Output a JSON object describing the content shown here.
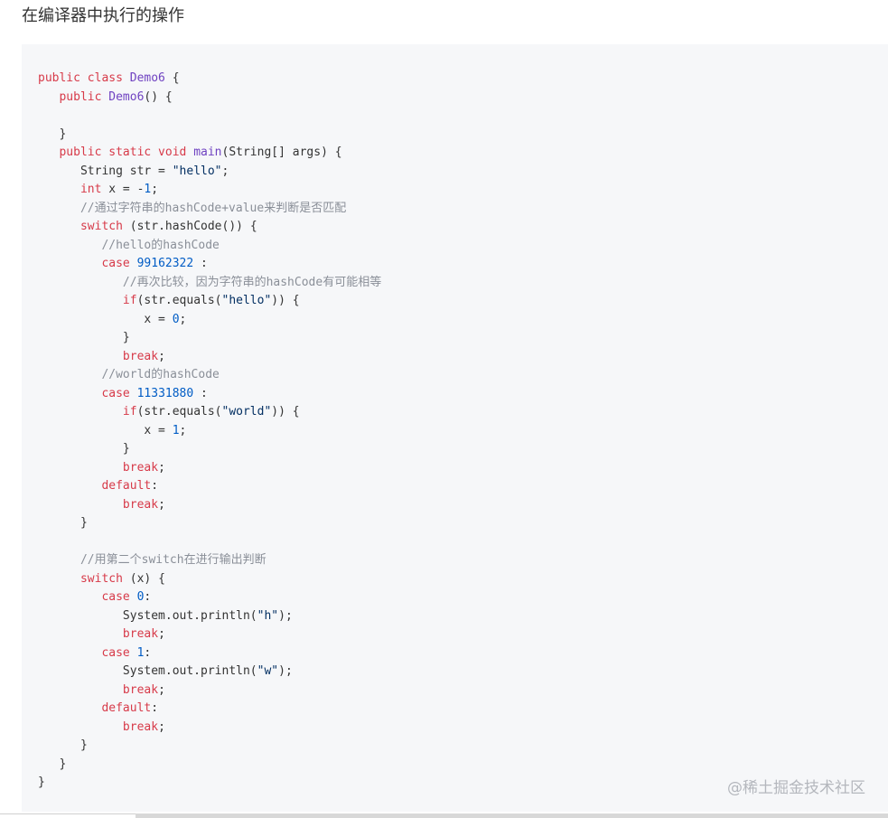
{
  "heading": "在编译器中执行的操作",
  "watermark": "@稀土掘金技术社区",
  "code_lines": [
    [
      {
        "t": "public class ",
        "c": "kw"
      },
      {
        "t": "Demo6",
        "c": "fn"
      },
      {
        "t": " {",
        "c": ""
      }
    ],
    [
      {
        "t": "   public ",
        "c": "kw"
      },
      {
        "t": "Demo6",
        "c": "fn"
      },
      {
        "t": "() {",
        "c": ""
      }
    ],
    [
      {
        "t": "",
        "c": ""
      }
    ],
    [
      {
        "t": "   }",
        "c": ""
      }
    ],
    [
      {
        "t": "   public static void ",
        "c": "kw"
      },
      {
        "t": "main",
        "c": "fn"
      },
      {
        "t": "(String[] args) {",
        "c": ""
      }
    ],
    [
      {
        "t": "      String str = ",
        "c": ""
      },
      {
        "t": "\"hello\"",
        "c": "str"
      },
      {
        "t": ";",
        "c": ""
      }
    ],
    [
      {
        "t": "      ",
        "c": ""
      },
      {
        "t": "int",
        "c": "kw"
      },
      {
        "t": " x = -",
        "c": ""
      },
      {
        "t": "1",
        "c": "num"
      },
      {
        "t": ";",
        "c": ""
      }
    ],
    [
      {
        "t": "      ",
        "c": ""
      },
      {
        "t": "//通过字符串的hashCode+value来判断是否匹配",
        "c": "com"
      }
    ],
    [
      {
        "t": "      ",
        "c": ""
      },
      {
        "t": "switch",
        "c": "kw"
      },
      {
        "t": " (str.hashCode()) {",
        "c": ""
      }
    ],
    [
      {
        "t": "         ",
        "c": ""
      },
      {
        "t": "//hello的hashCode",
        "c": "com"
      }
    ],
    [
      {
        "t": "         ",
        "c": ""
      },
      {
        "t": "case",
        "c": "kw"
      },
      {
        "t": " ",
        "c": ""
      },
      {
        "t": "99162322",
        "c": "num"
      },
      {
        "t": " :",
        "c": ""
      }
    ],
    [
      {
        "t": "            ",
        "c": ""
      },
      {
        "t": "//再次比较，因为字符串的hashCode有可能相等",
        "c": "com"
      }
    ],
    [
      {
        "t": "            ",
        "c": ""
      },
      {
        "t": "if",
        "c": "kw"
      },
      {
        "t": "(str.equals(",
        "c": ""
      },
      {
        "t": "\"hello\"",
        "c": "str"
      },
      {
        "t": ")) {",
        "c": ""
      }
    ],
    [
      {
        "t": "               x = ",
        "c": ""
      },
      {
        "t": "0",
        "c": "num"
      },
      {
        "t": ";",
        "c": ""
      }
    ],
    [
      {
        "t": "            }",
        "c": ""
      }
    ],
    [
      {
        "t": "            ",
        "c": ""
      },
      {
        "t": "break",
        "c": "kw"
      },
      {
        "t": ";",
        "c": ""
      }
    ],
    [
      {
        "t": "         ",
        "c": ""
      },
      {
        "t": "//world的hashCode",
        "c": "com"
      }
    ],
    [
      {
        "t": "         ",
        "c": ""
      },
      {
        "t": "case",
        "c": "kw"
      },
      {
        "t": " ",
        "c": ""
      },
      {
        "t": "11331880",
        "c": "num"
      },
      {
        "t": " :",
        "c": ""
      }
    ],
    [
      {
        "t": "            ",
        "c": ""
      },
      {
        "t": "if",
        "c": "kw"
      },
      {
        "t": "(str.equals(",
        "c": ""
      },
      {
        "t": "\"world\"",
        "c": "str"
      },
      {
        "t": ")) {",
        "c": ""
      }
    ],
    [
      {
        "t": "               x = ",
        "c": ""
      },
      {
        "t": "1",
        "c": "num"
      },
      {
        "t": ";",
        "c": ""
      }
    ],
    [
      {
        "t": "            }",
        "c": ""
      }
    ],
    [
      {
        "t": "            ",
        "c": ""
      },
      {
        "t": "break",
        "c": "kw"
      },
      {
        "t": ";",
        "c": ""
      }
    ],
    [
      {
        "t": "         ",
        "c": ""
      },
      {
        "t": "default",
        "c": "kw"
      },
      {
        "t": ":",
        "c": ""
      }
    ],
    [
      {
        "t": "            ",
        "c": ""
      },
      {
        "t": "break",
        "c": "kw"
      },
      {
        "t": ";",
        "c": ""
      }
    ],
    [
      {
        "t": "      }",
        "c": ""
      }
    ],
    [
      {
        "t": "",
        "c": ""
      }
    ],
    [
      {
        "t": "      ",
        "c": ""
      },
      {
        "t": "//用第二个switch在进行输出判断",
        "c": "com"
      }
    ],
    [
      {
        "t": "      ",
        "c": ""
      },
      {
        "t": "switch",
        "c": "kw"
      },
      {
        "t": " (x) {",
        "c": ""
      }
    ],
    [
      {
        "t": "         ",
        "c": ""
      },
      {
        "t": "case",
        "c": "kw"
      },
      {
        "t": " ",
        "c": ""
      },
      {
        "t": "0",
        "c": "num"
      },
      {
        "t": ":",
        "c": ""
      }
    ],
    [
      {
        "t": "            System.out.println(",
        "c": ""
      },
      {
        "t": "\"h\"",
        "c": "str"
      },
      {
        "t": ");",
        "c": ""
      }
    ],
    [
      {
        "t": "            ",
        "c": ""
      },
      {
        "t": "break",
        "c": "kw"
      },
      {
        "t": ";",
        "c": ""
      }
    ],
    [
      {
        "t": "         ",
        "c": ""
      },
      {
        "t": "case",
        "c": "kw"
      },
      {
        "t": " ",
        "c": ""
      },
      {
        "t": "1",
        "c": "num"
      },
      {
        "t": ":",
        "c": ""
      }
    ],
    [
      {
        "t": "            System.out.println(",
        "c": ""
      },
      {
        "t": "\"w\"",
        "c": "str"
      },
      {
        "t": ");",
        "c": ""
      }
    ],
    [
      {
        "t": "            ",
        "c": ""
      },
      {
        "t": "break",
        "c": "kw"
      },
      {
        "t": ";",
        "c": ""
      }
    ],
    [
      {
        "t": "         ",
        "c": ""
      },
      {
        "t": "default",
        "c": "kw"
      },
      {
        "t": ":",
        "c": ""
      }
    ],
    [
      {
        "t": "            ",
        "c": ""
      },
      {
        "t": "break",
        "c": "kw"
      },
      {
        "t": ";",
        "c": ""
      }
    ],
    [
      {
        "t": "      }",
        "c": ""
      }
    ],
    [
      {
        "t": "   }",
        "c": ""
      }
    ],
    [
      {
        "t": "}",
        "c": ""
      }
    ]
  ]
}
